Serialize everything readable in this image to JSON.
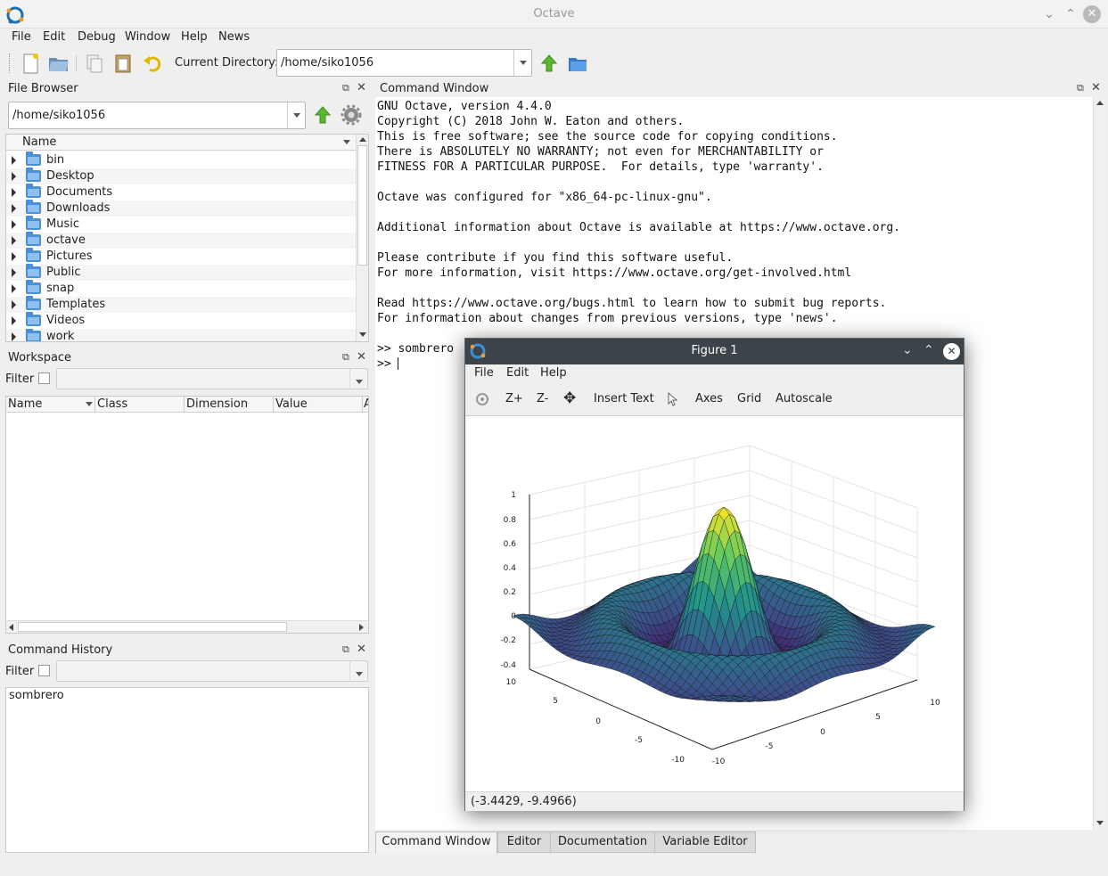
{
  "window": {
    "title": "Octave"
  },
  "menu": [
    "File",
    "Edit",
    "Debug",
    "Window",
    "Help",
    "News"
  ],
  "toolbar": {
    "current_dir_label": "Current Directory:",
    "current_dir_value": "/home/siko1056"
  },
  "file_browser": {
    "title": "File Browser",
    "path": "/home/siko1056",
    "column": "Name",
    "items": [
      "bin",
      "Desktop",
      "Documents",
      "Downloads",
      "Music",
      "octave",
      "Pictures",
      "Public",
      "snap",
      "Templates",
      "Videos",
      "work"
    ]
  },
  "workspace": {
    "title": "Workspace",
    "filter_label": "Filter",
    "columns": [
      "Name",
      "Class",
      "Dimension",
      "Value",
      "A"
    ]
  },
  "history": {
    "title": "Command History",
    "filter_label": "Filter",
    "items": [
      "sombrero"
    ]
  },
  "command_window": {
    "title": "Command Window",
    "lines": [
      "GNU Octave, version 4.4.0",
      "Copyright (C) 2018 John W. Eaton and others.",
      "This is free software; see the source code for copying conditions.",
      "There is ABSOLUTELY NO WARRANTY; not even for MERCHANTABILITY or",
      "FITNESS FOR A PARTICULAR PURPOSE.  For details, type 'warranty'.",
      "",
      "Octave was configured for \"x86_64-pc-linux-gnu\".",
      "",
      "Additional information about Octave is available at https://www.octave.org.",
      "",
      "Please contribute if you find this software useful.",
      "For more information, visit https://www.octave.org/get-involved.html",
      "",
      "Read https://www.octave.org/bugs.html to learn how to submit bug reports.",
      "For information about changes from previous versions, type 'news'.",
      "",
      ">> sombrero",
      ">> "
    ]
  },
  "tabs": [
    "Command Window",
    "Editor",
    "Documentation",
    "Variable Editor"
  ],
  "figure": {
    "title": "Figure 1",
    "menu": [
      "File",
      "Edit",
      "Help"
    ],
    "tools": {
      "zoom_in": "Z+",
      "zoom_out": "Z-",
      "insert_text": "Insert Text",
      "axes": "Axes",
      "grid": "Grid",
      "autoscale": "Autoscale"
    },
    "status": "(-3.4429, -9.4966)",
    "z_ticks": [
      "1",
      "0.8",
      "0.6",
      "0.4",
      "0.2",
      "0",
      "-0.2",
      "-0.4"
    ],
    "x_ticks": [
      "-10",
      "-5",
      "0",
      "5",
      "10"
    ],
    "y_ticks": [
      "-10",
      "-5",
      "0",
      "5",
      "10"
    ]
  },
  "chart_data": {
    "type": "surface",
    "function": "sombrero",
    "zlim": [
      -0.4,
      1
    ],
    "xlim": [
      -10,
      10
    ],
    "ylim": [
      -10,
      10
    ],
    "colormap": "viridis",
    "grid": true
  },
  "colors": {
    "accent_green": "#5bb82e",
    "folder_blue": "#4a90d9",
    "figure_titlebar": "#3d4449"
  }
}
